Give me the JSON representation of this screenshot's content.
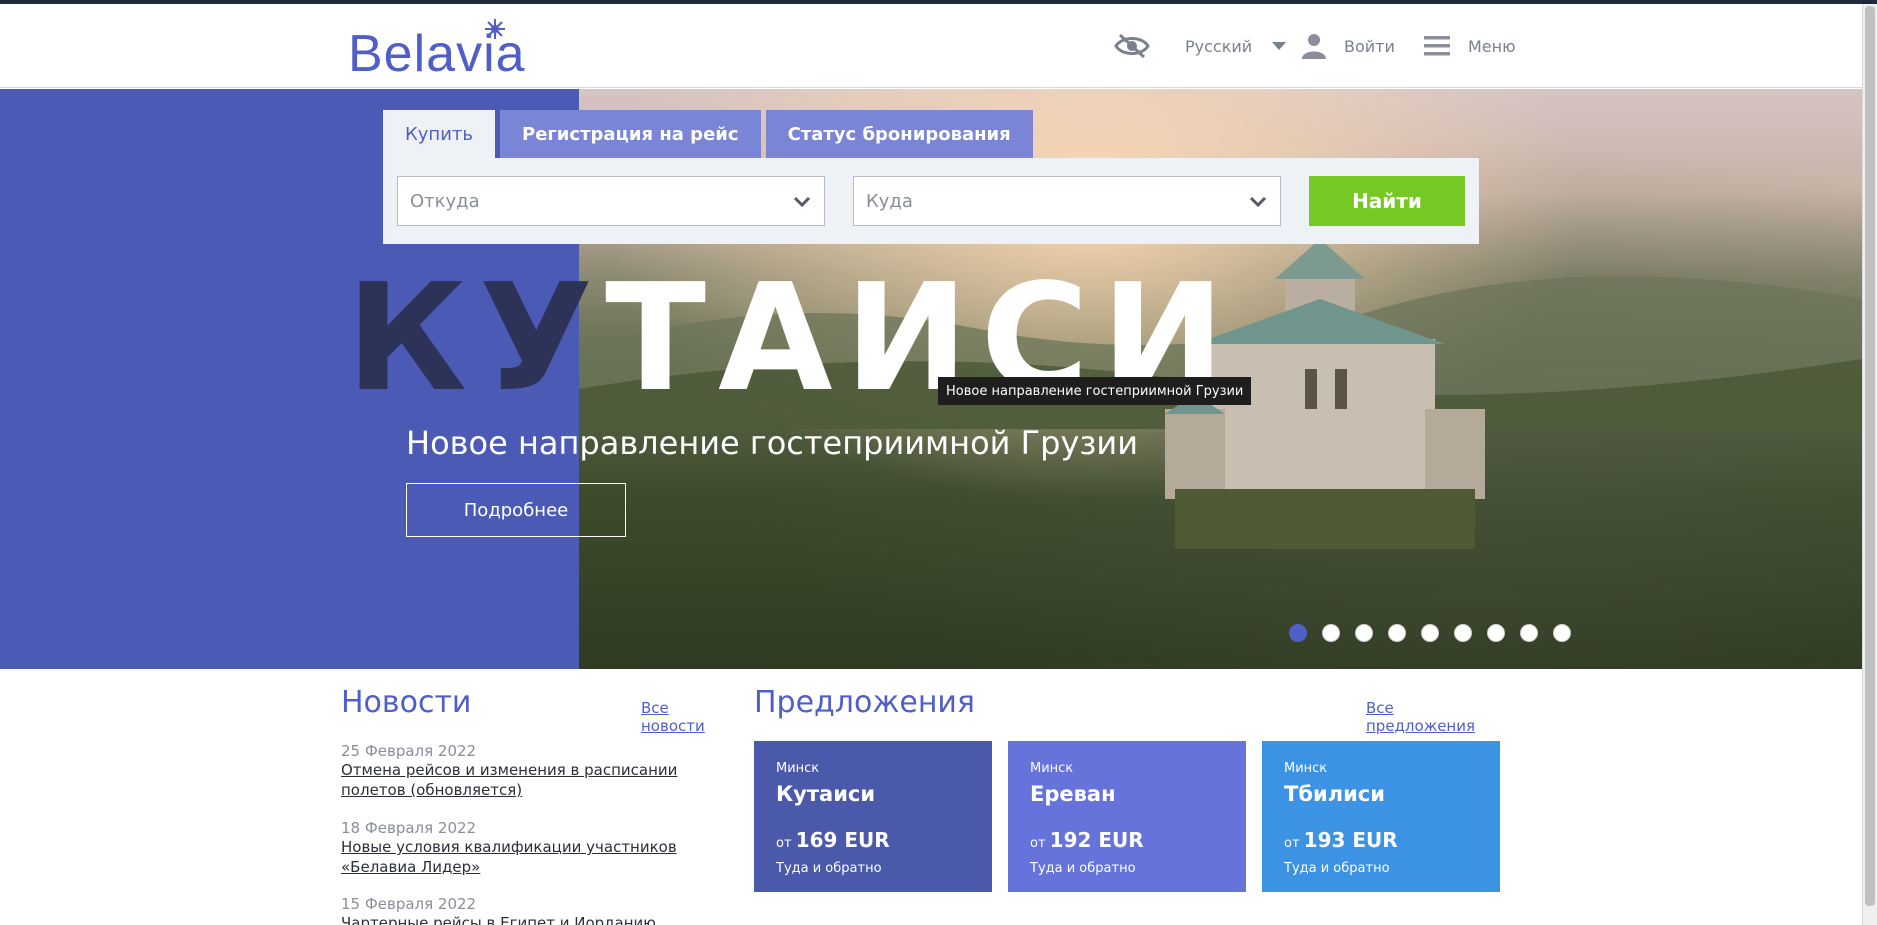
{
  "header": {
    "logo_text": "Belavia",
    "language": "Русский",
    "login": "Войти",
    "menu": "Меню"
  },
  "search": {
    "tabs": [
      {
        "label": "Купить",
        "active": true
      },
      {
        "label": "Регистрация на рейс",
        "active": false
      },
      {
        "label": "Статус бронирования",
        "active": false
      }
    ],
    "from_placeholder": "Откуда",
    "to_placeholder": "Куда",
    "find_label": "Найти"
  },
  "hero": {
    "title_dark": "КУ",
    "title_light": "ТАИСИ",
    "subtitle": "Новое направление гостеприимной Грузии",
    "button": "Подробнее",
    "tooltip": "Новое направление гостеприимной Грузии",
    "slides_total": 9,
    "active_slide": 1
  },
  "news": {
    "title": "Новости",
    "all_link": "Все новости",
    "items": [
      {
        "date": "25 Февраля 2022",
        "text": "Отмена рейсов и изменения в расписании полетов (обновляется)"
      },
      {
        "date": "18 Февраля 2022",
        "text": "Новые условия квалификации участников «Белавиа Лидер»"
      },
      {
        "date": "15 Февраля 2022",
        "text": "Чартерные рейсы в Египет и Иорданию"
      }
    ]
  },
  "offers": {
    "title": "Предложения",
    "all_link": "Все предложения",
    "cards": [
      {
        "from": "Минск",
        "to": "Кутаиси",
        "price_prefix": "от",
        "price": "169 EUR",
        "note": "Туда и обратно",
        "color": "#4b59ab"
      },
      {
        "from": "Минск",
        "to": "Ереван",
        "price_prefix": "от",
        "price": "192 EUR",
        "note": "Туда и обратно",
        "color": "#6673db"
      },
      {
        "from": "Минск",
        "to": "Тбилиси",
        "price_prefix": "от",
        "price": "193 EUR",
        "note": "Туда и обратно",
        "color": "#3c93e3"
      }
    ]
  },
  "colors": {
    "brand": "#4f5fc7",
    "cta_green": "#76c924"
  }
}
